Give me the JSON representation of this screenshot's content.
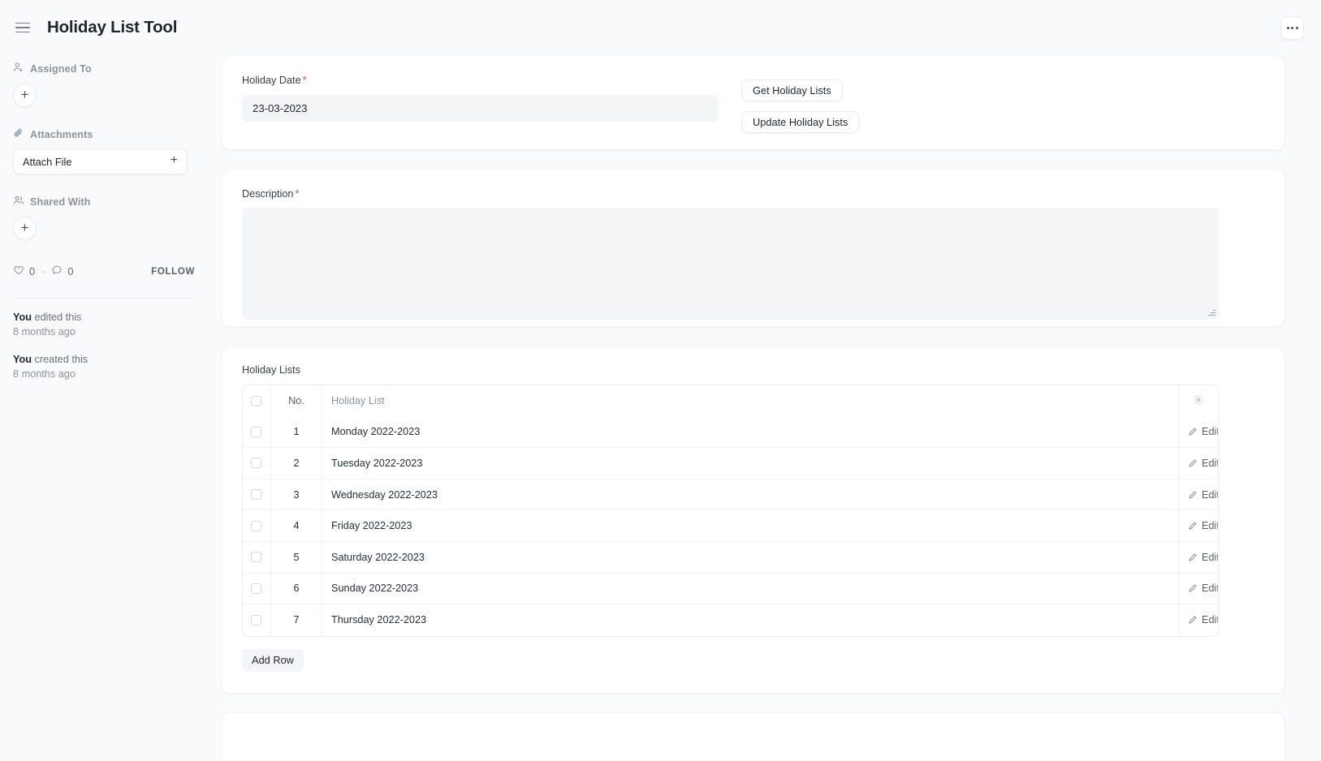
{
  "navbar": {
    "title": "Holiday List Tool",
    "menu_icon": "hamburger-icon",
    "more_icon": "ellipsis-icon"
  },
  "sidebar": {
    "assigned_to": {
      "label": "Assigned To",
      "icon": "user-plus-icon",
      "add_label": "+"
    },
    "attachments": {
      "label": "Attachments",
      "icon": "paperclip-icon",
      "attach_label": "Attach File",
      "add_label": "+"
    },
    "shared_with": {
      "label": "Shared With",
      "icon": "users-icon",
      "add_label": "+"
    },
    "social": {
      "like_count": "0",
      "comment_count": "0",
      "separator": "·",
      "follow_label": "FOLLOW"
    },
    "activity": [
      {
        "who": "You",
        "action": " edited this",
        "time": "8 months ago"
      },
      {
        "who": "You",
        "action": " created this",
        "time": "8 months ago"
      }
    ]
  },
  "main": {
    "date_section": {
      "label": "Holiday Date",
      "required_mark": "*",
      "value": "23-03-2023",
      "buttons": [
        {
          "label": "Get Holiday Lists"
        },
        {
          "label": "Update Holiday Lists"
        }
      ]
    },
    "description_section": {
      "label": "Description",
      "required_mark": "*",
      "value": "",
      "placeholder": ""
    },
    "table_section": {
      "title": "Holiday Lists",
      "columns": {
        "no": "No.",
        "name": "Holiday List",
        "settings_icon": "gear-icon"
      },
      "rows": [
        {
          "no": "1",
          "name": "Monday 2022-2023",
          "edit_label": "Edit"
        },
        {
          "no": "2",
          "name": "Tuesday 2022-2023",
          "edit_label": "Edit"
        },
        {
          "no": "3",
          "name": "Wednesday 2022-2023",
          "edit_label": "Edit"
        },
        {
          "no": "4",
          "name": "Friday 2022-2023",
          "edit_label": "Edit"
        },
        {
          "no": "5",
          "name": "Saturday 2022-2023",
          "edit_label": "Edit"
        },
        {
          "no": "6",
          "name": "Sunday 2022-2023",
          "edit_label": "Edit"
        },
        {
          "no": "7",
          "name": "Thursday 2022-2023",
          "edit_label": "Edit"
        }
      ],
      "add_row_label": "Add Row"
    }
  },
  "colors": {
    "page_bg": "#f8fafc",
    "card_bg": "#ffffff",
    "field_bg": "#f3f5f7",
    "text": "#1f272e",
    "muted": "#8d949b",
    "required": "#e24c4c",
    "border": "#eceff2"
  }
}
